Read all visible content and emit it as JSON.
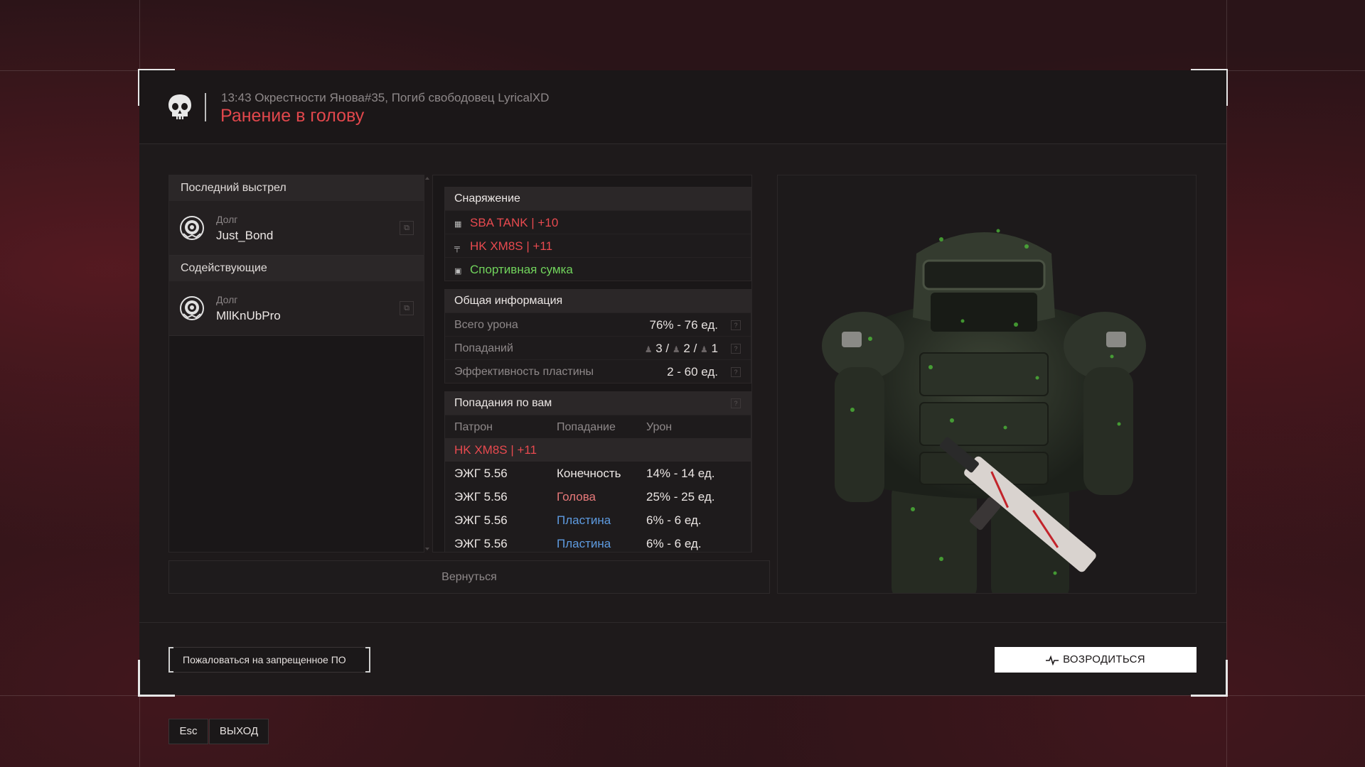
{
  "header": {
    "subtitle": "13:43 Окрестности Янова#35, Погиб свободовец LyricalXD",
    "title": "Ранение в голову"
  },
  "left_panel": {
    "last_shot_heading": "Последний выстрел",
    "assist_heading": "Содействующие",
    "killer": {
      "faction": "Долг",
      "name": "Just_Bond"
    },
    "assists": [
      {
        "faction": "Долг",
        "name": "MllKnUbPro"
      }
    ]
  },
  "equipment": {
    "heading": "Снаряжение",
    "items": [
      {
        "label": "SBA TANK | +10",
        "color": "#e84a4f",
        "icon": "armor-icon"
      },
      {
        "label": "HK XM8S | +11",
        "color": "#e84a4f",
        "icon": "rifle-icon"
      },
      {
        "label": "Спортивная сумка",
        "color": "#71d35c",
        "icon": "backpack-icon"
      }
    ]
  },
  "general_info": {
    "heading": "Общая информация",
    "total_damage_label": "Всего урона",
    "total_damage_value": "76% - 76 ед.",
    "hits_label": "Попаданий",
    "hits_a": "3",
    "hits_b": "2",
    "hits_c": "1",
    "plate_label": "Эффективность пластины",
    "plate_value": "2 - 60 ед."
  },
  "hits_on_you": {
    "heading": "Попадания по вам",
    "columns": [
      "Патрон",
      "Попадание",
      "Урон"
    ],
    "weapon": "HK XM8S | +11",
    "rows": [
      {
        "ammo": "ЭЖГ 5.56",
        "zone": "Конечность",
        "damage": "14% - 14 ед."
      },
      {
        "ammo": "ЭЖГ 5.56",
        "zone": "Голова",
        "damage": "25% - 25 ед."
      },
      {
        "ammo": "ЭЖГ 5.56",
        "zone": "Пластина",
        "damage": "6% - 6 ед."
      },
      {
        "ammo": "ЭЖГ 5.56",
        "zone": "Пластина",
        "damage": "6% - 6 ед."
      }
    ]
  },
  "buttons": {
    "back": "Вернуться",
    "report": "Пожаловаться на запрещенное ПО",
    "respawn": "ВОЗРОДИТЬСЯ",
    "esc_key": "Esc",
    "exit": "ВЫХОД"
  },
  "colors": {
    "accent_red": "#e2474c",
    "friendly_green": "#71d35c",
    "plate_blue": "#5e9be0"
  }
}
